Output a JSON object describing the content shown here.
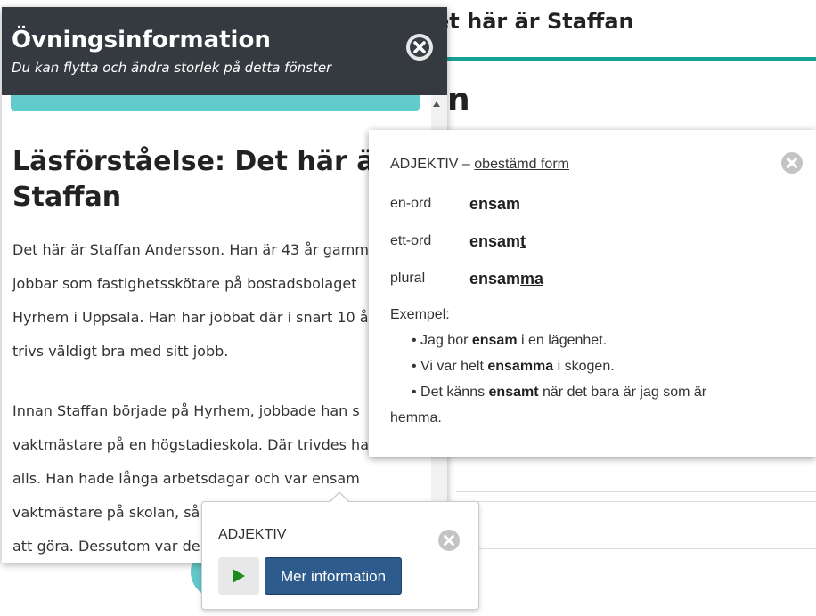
{
  "background": {
    "page_title": "et här är Staffan",
    "heading_fragment": "n"
  },
  "info_window": {
    "title": "Övningsinformation",
    "subtitle": "Du kan flytta och ändra storlek på detta fönster",
    "reading_title": "Läsförståelse: Det här är Staffan",
    "paragraph1": [
      "Det här är Staffan Andersson. Han är 43 år gamm",
      "jobbar som fastighetsskötare på bostadsbolaget",
      "Hyrhem i Uppsala. Han har jobbat där i snart 10 å",
      "trivs väldigt bra med sitt jobb."
    ],
    "paragraph2": [
      "Innan Staffan började på Hyrhem, jobbade han s",
      "vaktmästare på en högstadieskola. Där trivdes ha",
      "alls. Han hade långa arbetsdagar och var ensam",
      "vaktmästare på skolan, så",
      "att göra. Dessutom var de"
    ]
  },
  "word_popup": {
    "word_class": "ADJEKTIV",
    "separator": " – ",
    "form_link": "obestämd form",
    "forms": [
      {
        "label": "en-ord",
        "stem": "ensam",
        "ending": ""
      },
      {
        "label": "ett-ord",
        "stem": "ensam",
        "ending": "t"
      },
      {
        "label": "plural",
        "stem": "ensam",
        "ending": "ma"
      }
    ],
    "examples_label": "Exempel:",
    "examples": [
      {
        "before": "• Jag bor ",
        "word": "ensam",
        "after": " i en lägenhet."
      },
      {
        "before": "• Vi var helt ",
        "word": "ensamma",
        "after": " i skogen."
      },
      {
        "before": "• Det känns ",
        "word": "ensamt",
        "after": " när det bara är jag som är"
      }
    ],
    "example_continuation": "hemma."
  },
  "small_popup": {
    "word_class": "ADJEKTIV",
    "more_info_label": "Mer information"
  },
  "colors": {
    "header_bg": "#343a40",
    "teal": "#16a394",
    "player_bar": "#62cccd",
    "button_blue": "#2c5b8c",
    "play_green": "#1e8a1e"
  },
  "icons": {
    "close": "close-circle-icon",
    "play": "play-icon"
  }
}
